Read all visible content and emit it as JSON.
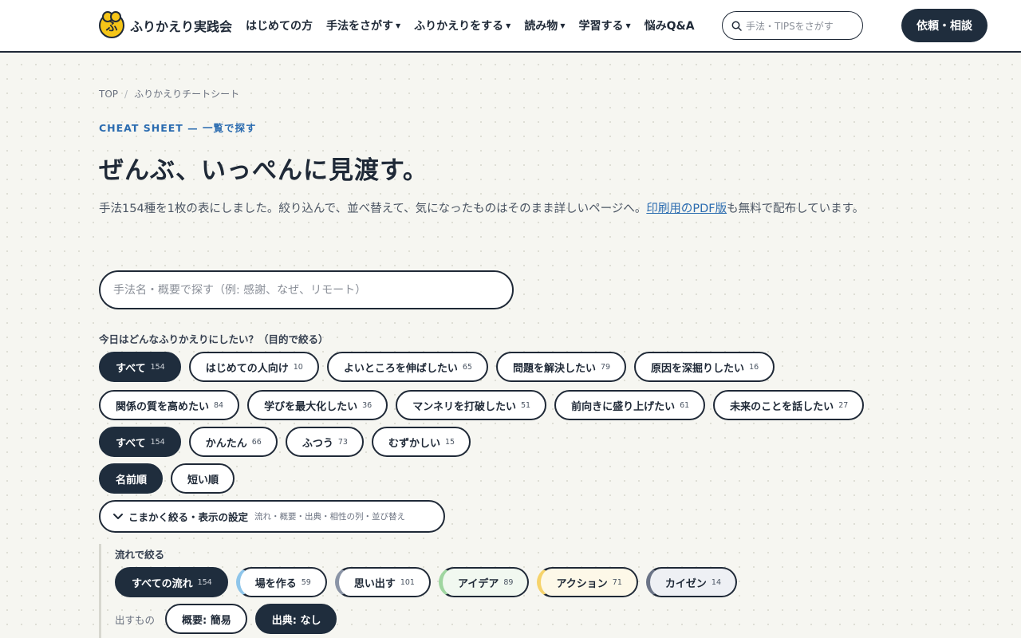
{
  "header": {
    "logo_glyph": "ふ",
    "site_name": "ふりかえり実践会",
    "nav": [
      {
        "label": "はじめての方",
        "dropdown": false
      },
      {
        "label": "手法をさがす",
        "dropdown": true
      },
      {
        "label": "ふりかえりをする",
        "dropdown": true
      },
      {
        "label": "読み物",
        "dropdown": true
      },
      {
        "label": "学習する",
        "dropdown": true
      },
      {
        "label": "悩みQ&A",
        "dropdown": false
      }
    ],
    "caret": "▼",
    "search_placeholder": "手法・TIPSをさがす",
    "cta_label": "依頼・相談"
  },
  "breadcrumb": {
    "home": "TOP",
    "separator": "/",
    "current": "ふりかえりチートシート"
  },
  "eyebrow": "CHEAT SHEET — 一覧で探す",
  "title": "ぜんぶ、いっぺんに見渡す。",
  "lead": {
    "before": "手法154種を1枚の表にしました。絞り込んで、並べ替えて、気になったものはそのまま詳しいページへ。",
    "link": "印刷用のPDF版",
    "after": "も無料で配布しています。"
  },
  "search": {
    "placeholder": "手法名・概要で探す（例: 感謝、なぜ、リモート）",
    "value": ""
  },
  "purpose": {
    "label": "今日はどんなふりかえりにしたい？（目的で絞る）",
    "chips": [
      {
        "label": "すべて",
        "count": "154",
        "active": true
      },
      {
        "label": "はじめての人向け",
        "count": "10",
        "active": false
      },
      {
        "label": "よいところを伸ばしたい",
        "count": "65",
        "active": false
      },
      {
        "label": "問題を解決したい",
        "count": "79",
        "active": false
      },
      {
        "label": "原因を深掘りしたい",
        "count": "16",
        "active": false
      },
      {
        "label": "関係の質を高めたい",
        "count": "84",
        "active": false
      },
      {
        "label": "学びを最大化したい",
        "count": "36",
        "active": false
      },
      {
        "label": "マンネリを打破したい",
        "count": "51",
        "active": false
      },
      {
        "label": "前向きに盛り上げたい",
        "count": "61",
        "active": false
      },
      {
        "label": "未来のことを話したい",
        "count": "27",
        "active": false
      }
    ]
  },
  "difficulty": {
    "chips": [
      {
        "label": "すべて",
        "count": "154",
        "active": true
      },
      {
        "label": "かんたん",
        "count": "66",
        "active": false
      },
      {
        "label": "ふつう",
        "count": "73",
        "active": false
      },
      {
        "label": "むずかしい",
        "count": "15",
        "active": false
      }
    ]
  },
  "sort": {
    "chips": [
      {
        "label": "名前順",
        "active": true
      },
      {
        "label": "短い順",
        "active": false
      }
    ]
  },
  "details": {
    "chevron": "chevron-down-icon",
    "label": "こまかく絞る・表示の設定",
    "sub": "流れ・概要・出典・相性の列・並び替え"
  },
  "flow": {
    "label": "流れで絞る",
    "chips": [
      {
        "label": "すべての流れ",
        "count": "154",
        "active": true,
        "accent": "#1f2d3d"
      },
      {
        "label": "場を作る",
        "count": "59",
        "active": false,
        "accent": "#8ec5ea"
      },
      {
        "label": "思い出す",
        "count": "101",
        "active": false,
        "accent": "#8a94a6"
      },
      {
        "label": "アイデア",
        "count": "89",
        "active": false,
        "accent": "#9fd6a0"
      },
      {
        "label": "アクション",
        "count": "71",
        "active": false,
        "accent": "#f6d36b"
      },
      {
        "label": "カイゼン",
        "count": "14",
        "active": false,
        "accent": "#6b7487"
      }
    ]
  },
  "output": {
    "label": "出すもの",
    "chips": [
      {
        "label": "概要: 簡易",
        "active": false
      },
      {
        "label": "出典: なし",
        "active": true
      }
    ]
  },
  "colors": {
    "accent": "#1f2d3d",
    "link": "#2b6cb0"
  }
}
